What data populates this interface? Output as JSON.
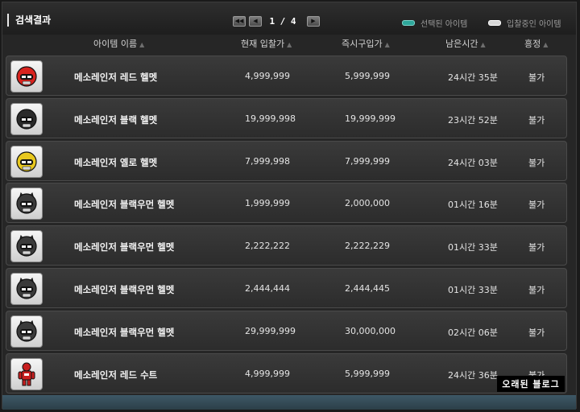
{
  "header": {
    "title": "검색결과",
    "page_info": "1 / 4",
    "legend_selected": "선택된 아이템",
    "legend_bidding": "입찰중인 아이템"
  },
  "columns": {
    "name": "아이템 이름",
    "current_bid": "현재 입찰가",
    "buyout": "즉시구입가",
    "time_left": "남은시간",
    "haggle": "흥정"
  },
  "rows": [
    {
      "name": "메소레인저 레드 헬멧",
      "current_bid": "4,999,999",
      "buyout": "5,999,999",
      "time_left": "24시간 35분",
      "haggle": "불가",
      "icon": "red-helmet-icon",
      "color": "#d8231e"
    },
    {
      "name": "메소레인저 블랙 헬멧",
      "current_bid": "19,999,998",
      "buyout": "19,999,999",
      "time_left": "23시간 52분",
      "haggle": "불가",
      "icon": "black-helmet-icon",
      "color": "#2a2a2a"
    },
    {
      "name": "메소레인저 옐로 헬멧",
      "current_bid": "7,999,998",
      "buyout": "7,999,999",
      "time_left": "24시간 03분",
      "haggle": "불가",
      "icon": "yellow-helmet-icon",
      "color": "#e8c81e"
    },
    {
      "name": "메소레인저 블랙우먼 헬멧",
      "current_bid": "1,999,999",
      "buyout": "2,000,000",
      "time_left": "01시간 16분",
      "haggle": "불가",
      "icon": "blackwoman-helmet-icon",
      "color": "#3a3a3a"
    },
    {
      "name": "메소레인저 블랙우먼 헬멧",
      "current_bid": "2,222,222",
      "buyout": "2,222,229",
      "time_left": "01시간 33분",
      "haggle": "불가",
      "icon": "blackwoman-helmet-icon",
      "color": "#3a3a3a"
    },
    {
      "name": "메소레인저 블랙우먼 헬멧",
      "current_bid": "2,444,444",
      "buyout": "2,444,445",
      "time_left": "01시간 33분",
      "haggle": "불가",
      "icon": "blackwoman-helmet-icon",
      "color": "#3a3a3a"
    },
    {
      "name": "메소레인저 블랙우먼 헬멧",
      "current_bid": "29,999,999",
      "buyout": "30,000,000",
      "time_left": "02시간 06분",
      "haggle": "불가",
      "icon": "blackwoman-helmet-icon",
      "color": "#3a3a3a"
    },
    {
      "name": "메소레인저 레드 수트",
      "current_bid": "4,999,999",
      "buyout": "5,999,999",
      "time_left": "24시간 36분",
      "haggle": "불가",
      "icon": "red-suit-icon",
      "color": "#c81e1e"
    }
  ],
  "watermark": "오래된 블로그"
}
